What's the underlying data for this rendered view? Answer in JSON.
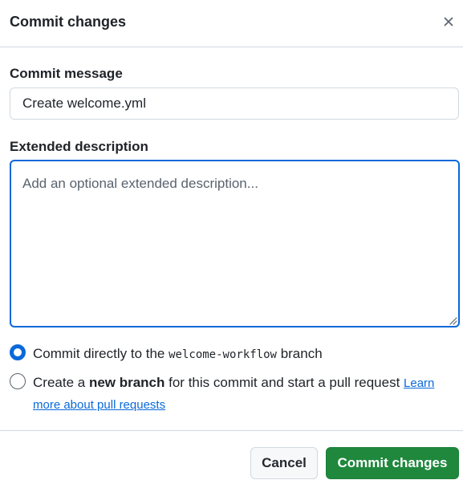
{
  "dialog": {
    "title": "Commit changes",
    "close_icon": "close-icon"
  },
  "commit_message": {
    "label": "Commit message",
    "value": "Create welcome.yml"
  },
  "extended_description": {
    "label": "Extended description",
    "placeholder": "Add an optional extended description..."
  },
  "options": {
    "direct": {
      "checked": true,
      "prefix": "Commit directly to the ",
      "branch": "welcome-workflow",
      "suffix": " branch"
    },
    "new_branch": {
      "checked": false,
      "prefix": "Create a ",
      "bold": "new branch",
      "suffix": " for this commit and start a pull request ",
      "link_line1": "Learn",
      "link_line2": "more about pull requests"
    }
  },
  "footer": {
    "cancel_label": "Cancel",
    "commit_label": "Commit changes"
  },
  "colors": {
    "accent": "#0969da",
    "primary_button": "#1f883d",
    "border": "#d1d9e0"
  }
}
